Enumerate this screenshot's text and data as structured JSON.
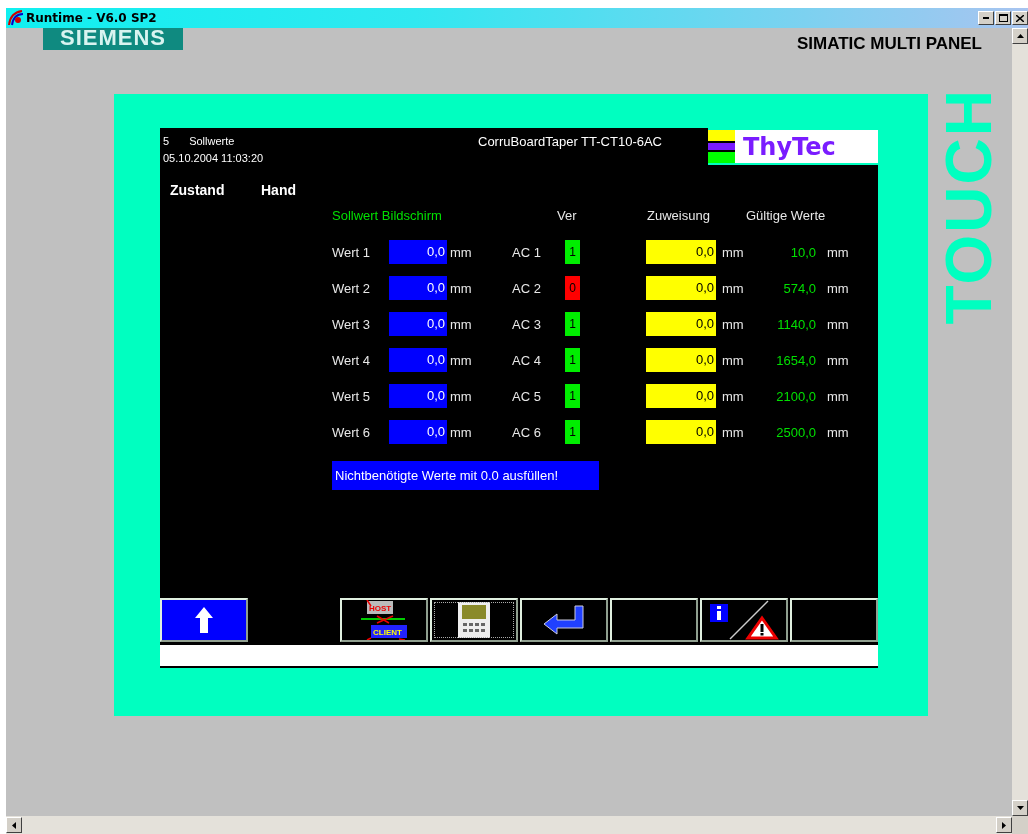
{
  "window": {
    "title": "Runtime - V6.0 SP2"
  },
  "panel": {
    "brand": "SIEMENS",
    "model": "SIMATIC MULTI PANEL",
    "side_label": "TOUCH"
  },
  "screen": {
    "number": "5",
    "name": "Sollwerte",
    "datetime": "05.10.2004 11:03:20",
    "title": "CorruBoardTaper TT-CT10-6AC",
    "logo": "ThyTec",
    "status": {
      "label": "Zustand",
      "value": "Hand"
    },
    "columns": [
      "Sollwert Bildschirm",
      "Ver",
      "Zuweisung",
      "Gültige Werte"
    ],
    "rows": [
      {
        "label": "Wert 1",
        "value": "0,0",
        "unit": "mm",
        "ac": "AC 1",
        "ver": "1",
        "ver_ok": true,
        "assigned": "0,0",
        "assigned_unit": "mm",
        "valid": "10,0",
        "valid_unit": "mm"
      },
      {
        "label": "Wert 2",
        "value": "0,0",
        "unit": "mm",
        "ac": "AC 2",
        "ver": "0",
        "ver_ok": false,
        "assigned": "0,0",
        "assigned_unit": "mm",
        "valid": "574,0",
        "valid_unit": "mm"
      },
      {
        "label": "Wert 3",
        "value": "0,0",
        "unit": "mm",
        "ac": "AC 3",
        "ver": "1",
        "ver_ok": true,
        "assigned": "0,0",
        "assigned_unit": "mm",
        "valid": "1140,0",
        "valid_unit": "mm"
      },
      {
        "label": "Wert 4",
        "value": "0,0",
        "unit": "mm",
        "ac": "AC 4",
        "ver": "1",
        "ver_ok": true,
        "assigned": "0,0",
        "assigned_unit": "mm",
        "valid": "1654,0",
        "valid_unit": "mm"
      },
      {
        "label": "Wert 5",
        "value": "0,0",
        "unit": "mm",
        "ac": "AC 5",
        "ver": "1",
        "ver_ok": true,
        "assigned": "0,0",
        "assigned_unit": "mm",
        "valid": "2100,0",
        "valid_unit": "mm"
      },
      {
        "label": "Wert 6",
        "value": "0,0",
        "unit": "mm",
        "ac": "AC 6",
        "ver": "1",
        "ver_ok": true,
        "assigned": "0,0",
        "assigned_unit": "mm",
        "valid": "2500,0",
        "valid_unit": "mm"
      }
    ],
    "note": "Nichtbenötigte Werte mit 0.0 ausfüllen!",
    "buttons": [
      {
        "kind": "up",
        "focused": false
      },
      {
        "kind": "host-client",
        "texts": [
          "HOST",
          "CLIENT"
        ],
        "focused": false
      },
      {
        "kind": "panel",
        "focused": true
      },
      {
        "kind": "enter",
        "focused": false
      },
      {
        "kind": "empty",
        "focused": false
      },
      {
        "kind": "info-warning",
        "focused": false
      },
      {
        "kind": "empty",
        "focused": false
      }
    ]
  }
}
